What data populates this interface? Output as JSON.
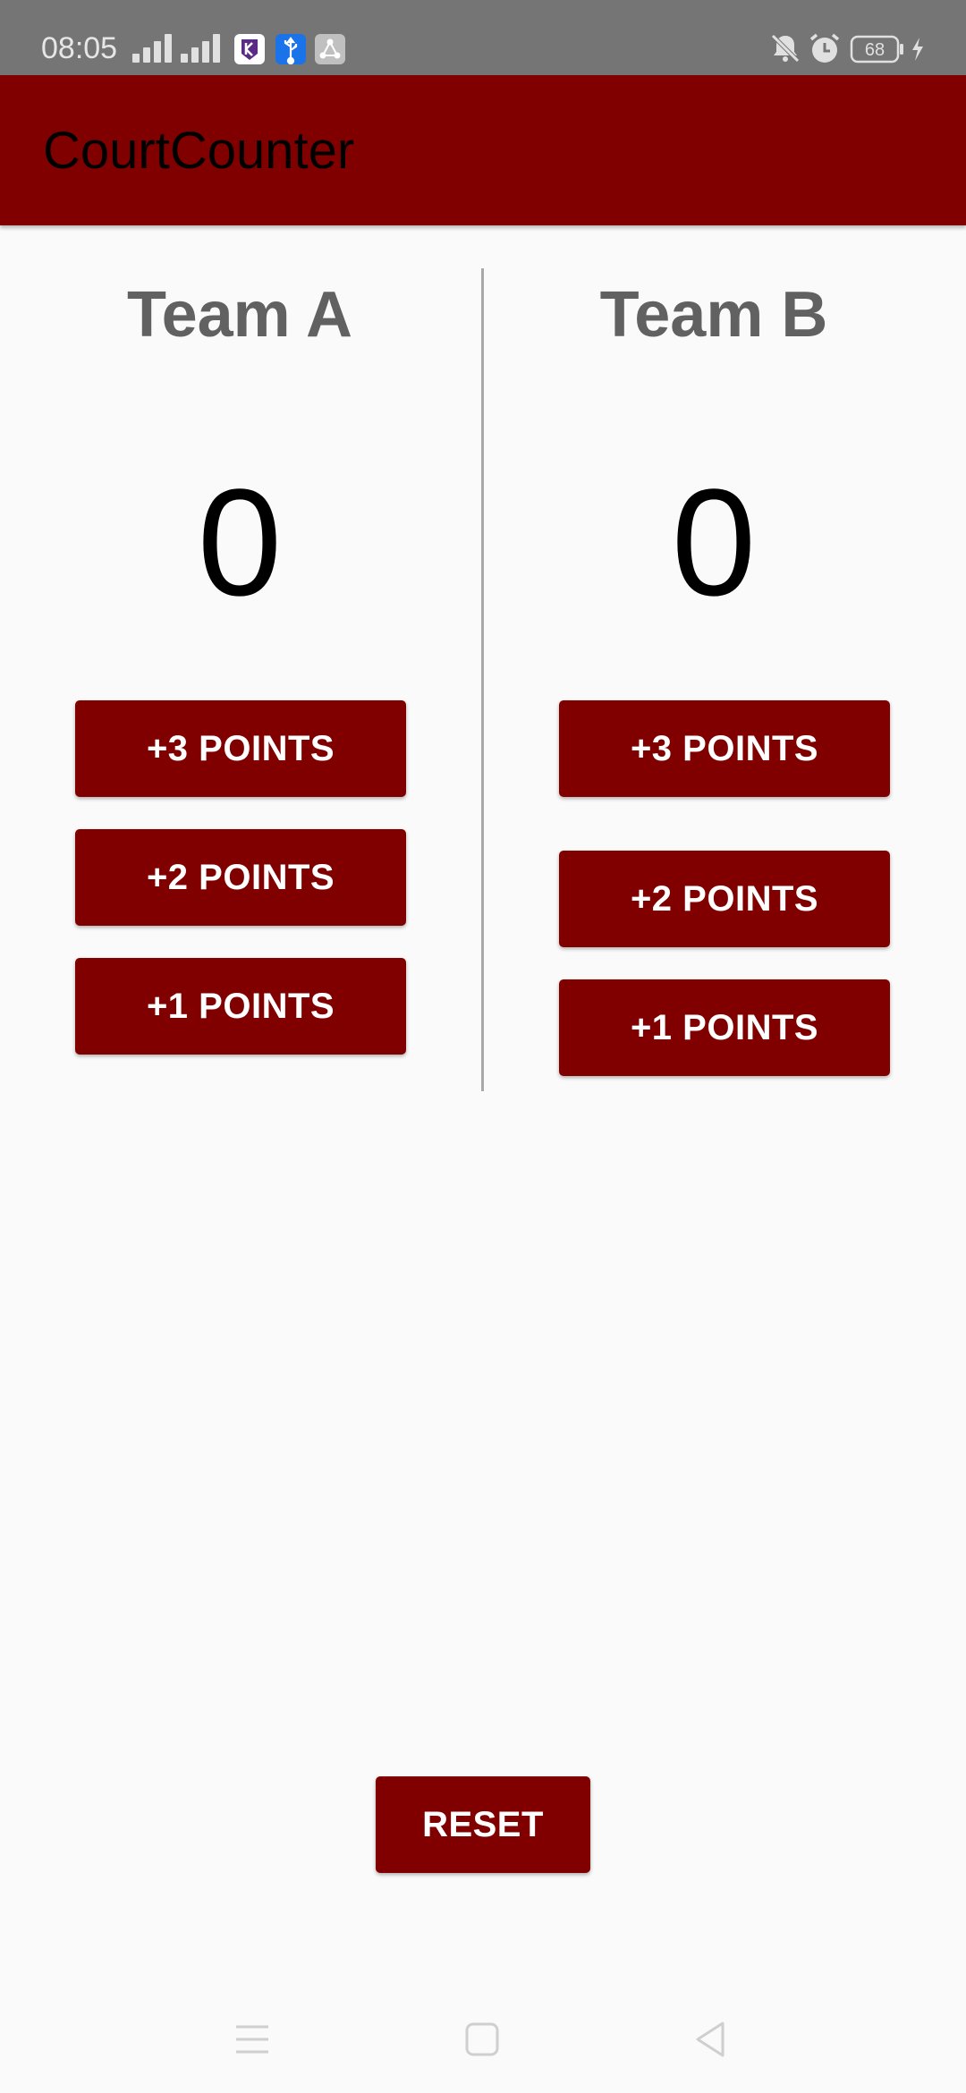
{
  "status_bar": {
    "time": "08:05",
    "battery_level": "68",
    "icons": [
      "signal-icon",
      "signal-icon",
      "k-app-icon",
      "usb-icon",
      "share-app-icon",
      "bell-off-icon",
      "alarm-icon",
      "battery-icon",
      "charging-icon"
    ]
  },
  "app_bar": {
    "title": "CourtCounter"
  },
  "teams": [
    {
      "name": "Team A",
      "score": "0",
      "buttons": [
        "+3 POINTS",
        "+2 POINTS",
        "+1 POINTS"
      ]
    },
    {
      "name": "Team B",
      "score": "0",
      "buttons": [
        "+3 POINTS",
        "+2 POINTS",
        "+1 POINTS"
      ]
    }
  ],
  "reset_label": "RESET",
  "nav_bar": {
    "icons": [
      "menu-icon",
      "home-icon",
      "back-icon"
    ]
  },
  "colors": {
    "primary": "#800000",
    "status_bar": "#757575",
    "background": "#fafafa",
    "team_name": "#616161"
  }
}
